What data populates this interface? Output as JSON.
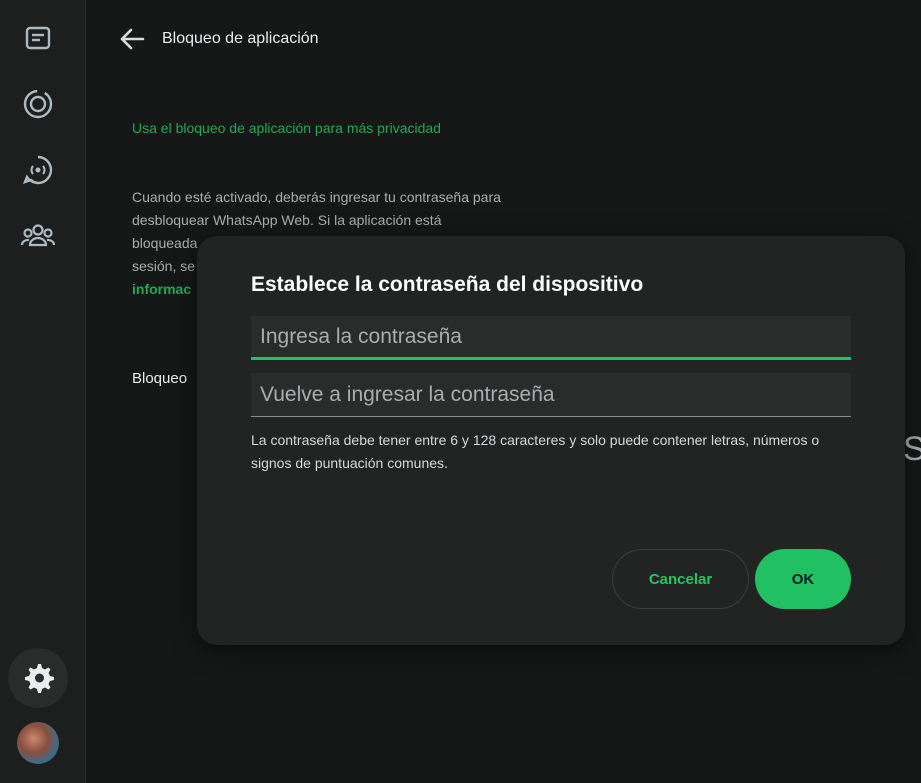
{
  "sidebar": {
    "icons": [
      "chats-icon",
      "status-icon",
      "channels-icon",
      "communities-icon",
      "settings-icon"
    ],
    "active": "settings-icon"
  },
  "header": {
    "title": "Bloqueo de aplicación"
  },
  "content": {
    "subtitle": "Usa el bloqueo de aplicación para más privacidad",
    "description_lines": [
      "Cuando esté activado, deberás ingresar tu contraseña para",
      "desbloquear WhatsApp Web. Si la aplicación está",
      "bloqueada",
      "sesión, se"
    ],
    "link_partial": "informac",
    "row_label_partial": "Bloqueo",
    "edge_letter": "S"
  },
  "dialog": {
    "title": "Establece la contraseña del dispositivo",
    "password_placeholder": "Ingresa la contraseña",
    "confirm_placeholder": "Vuelve a ingresar la contraseña",
    "hint": "La contraseña debe tener entre 6 y 128 caracteres y solo puede contener letras, números o signos de puntuación comunes.",
    "cancel_label": "Cancelar",
    "ok_label": "OK"
  },
  "colors": {
    "accent": "#21c063",
    "background": "#161717",
    "dialog": "#222424"
  }
}
